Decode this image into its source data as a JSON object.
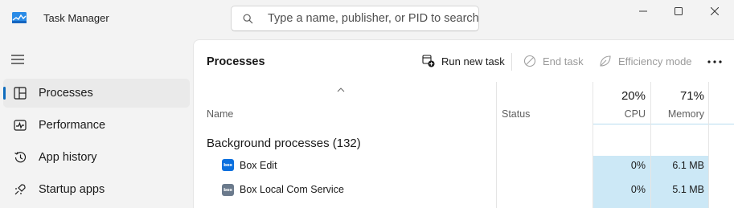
{
  "window": {
    "title": "Task Manager",
    "controls": {
      "minimize": "minimize-icon",
      "maximize": "maximize-icon",
      "close": "close-icon"
    }
  },
  "search": {
    "placeholder": "Type a name, publisher, or PID to search"
  },
  "sidebar": {
    "items": [
      {
        "label": "Processes",
        "icon": "processes-icon",
        "active": true
      },
      {
        "label": "Performance",
        "icon": "performance-icon",
        "active": false
      },
      {
        "label": "App history",
        "icon": "app-history-icon",
        "active": false
      },
      {
        "label": "Startup apps",
        "icon": "startup-apps-icon",
        "active": false
      }
    ]
  },
  "main": {
    "title": "Processes",
    "commands": {
      "run_new_task": "Run new task",
      "end_task": "End task",
      "efficiency_mode": "Efficiency mode"
    }
  },
  "table": {
    "columns": {
      "name": "Name",
      "status": "Status",
      "cpu": {
        "percent": "20%",
        "label": "CPU"
      },
      "memory": {
        "percent": "71%",
        "label": "Memory"
      }
    },
    "group": {
      "title": "Background processes (132)"
    },
    "rows": [
      {
        "name": "Box Edit",
        "icon_text": "box",
        "icon_color": "#0a6fde",
        "status": "",
        "cpu": "0%",
        "memory": "6.1 MB"
      },
      {
        "name": "Box Local Com Service",
        "icon_text": "box",
        "icon_color": "#6b7a8c",
        "status": "",
        "cpu": "0%",
        "memory": "5.1 MB"
      }
    ]
  },
  "colors": {
    "accent": "#0f6cbd",
    "cell_highlight": "#cce8f6",
    "sidebar_bg": "#f3f3f3",
    "panel_bg": "#ffffff"
  }
}
